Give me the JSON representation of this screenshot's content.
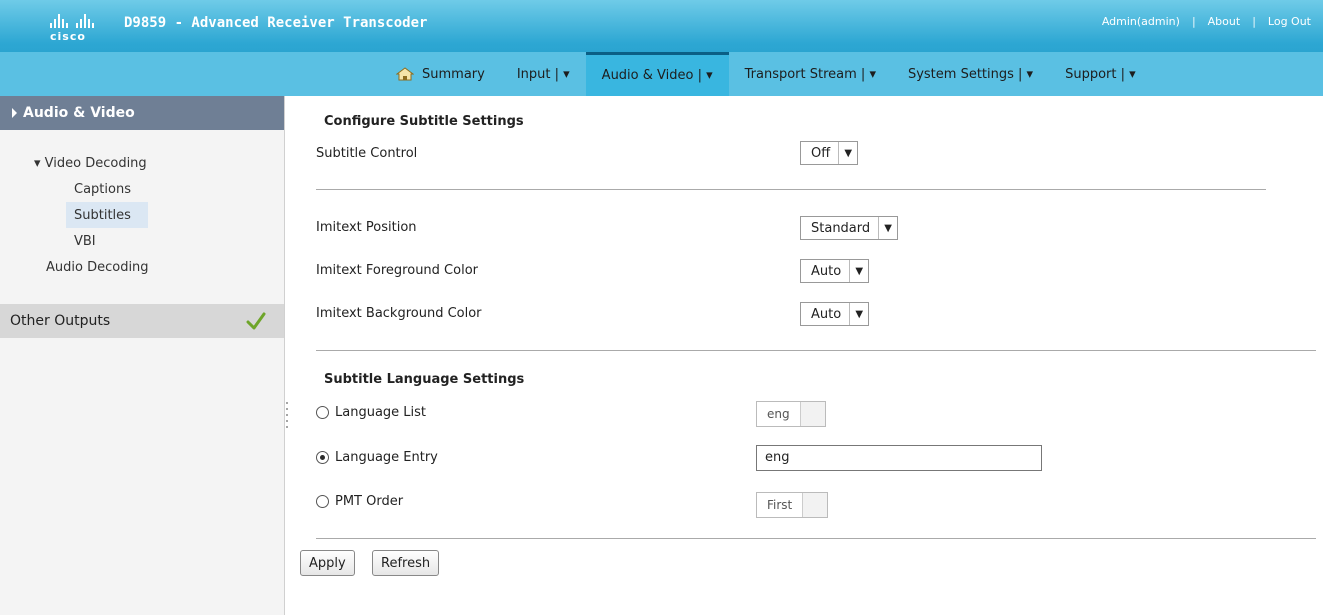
{
  "header": {
    "brand": "cisco",
    "title": "D9859 - Advanced Receiver Transcoder",
    "user": "Admin(admin)",
    "about": "About",
    "logout": "Log Out",
    "separator": "|"
  },
  "nav": [
    {
      "label": "Summary"
    },
    {
      "label": "Input | ▾"
    },
    {
      "label": "Audio & Video | ▾"
    },
    {
      "label": "Transport Stream | ▾"
    },
    {
      "label": "System Settings | ▾"
    },
    {
      "label": "Support | ▾"
    }
  ],
  "sidebar": {
    "heading": "Audio & Video",
    "items": {
      "video_decoding": "▾ Video Decoding",
      "captions": "Captions",
      "subtitles": "Subtitles",
      "vbi": "VBI",
      "audio_decoding": "Audio Decoding"
    },
    "other_outputs": "Other Outputs"
  },
  "main": {
    "section1_title": "Configure Subtitle Settings",
    "subtitle_control_label": "Subtitle Control",
    "subtitle_control_value": "Off",
    "imitext_position_label": "Imitext Position",
    "imitext_position_value": "Standard",
    "imitext_fg_label": "Imitext Foreground Color",
    "imitext_fg_value": "Auto",
    "imitext_bg_label": "Imitext Background Color",
    "imitext_bg_value": "Auto",
    "section2_title": "Subtitle Language Settings",
    "language_list_label": "Language List",
    "language_list_value": "eng",
    "language_entry_label": "Language Entry",
    "language_entry_value": "eng",
    "pmt_order_label": "PMT Order",
    "pmt_order_value": "First",
    "apply_label": "Apply",
    "refresh_label": "Refresh"
  },
  "colors": {
    "header_blue": "#2da7d3",
    "nav_blue": "#5ac0e3",
    "sidebar_head": "#6f7f95",
    "check_green": "#6ea52a"
  }
}
